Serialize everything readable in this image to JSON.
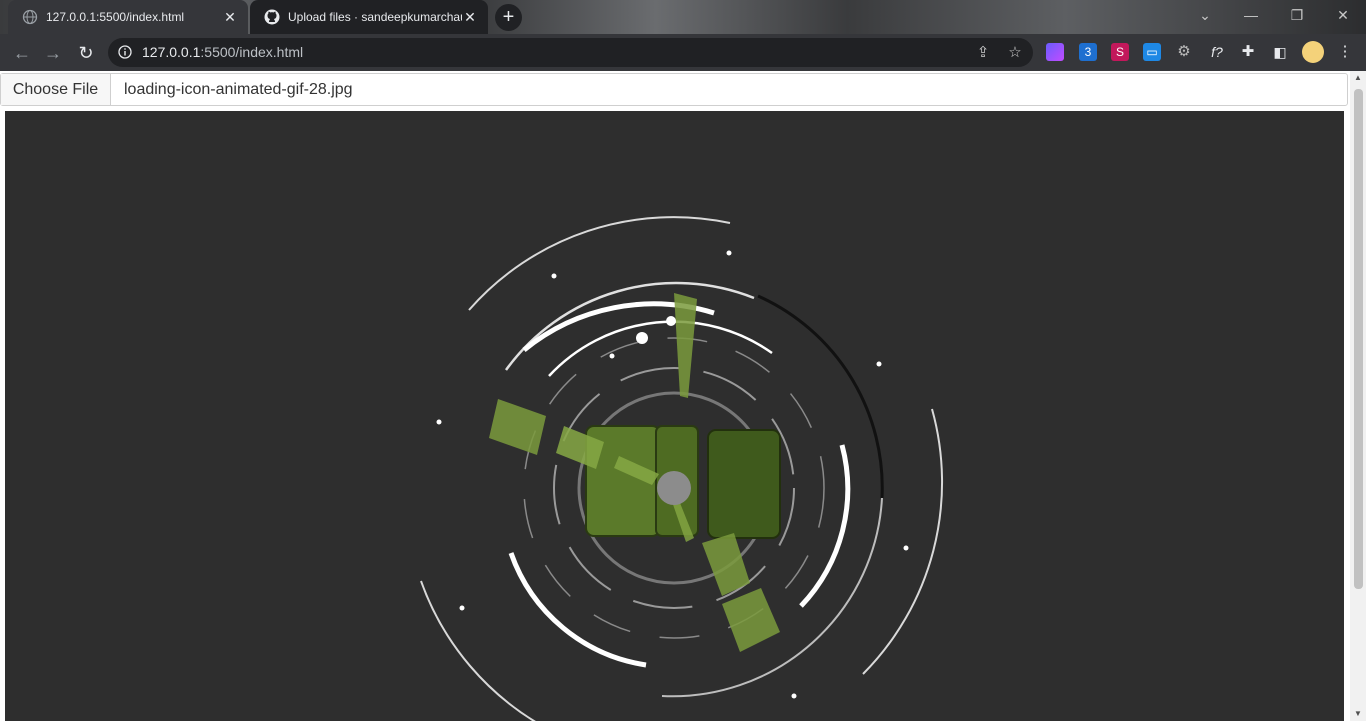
{
  "tabs": [
    {
      "title": "127.0.0.1:5500/index.html",
      "active": true,
      "icon": "globe-icon"
    },
    {
      "title": "Upload files · sandeepkumarchau",
      "active": false,
      "icon": "github-icon"
    }
  ],
  "toolbar": {
    "url_host": "127.0.0.1",
    "url_rest": ":5500/index.html"
  },
  "extensions": [
    "extension-1-icon",
    "css-extension-icon",
    "extension-3-icon",
    "extension-4-icon",
    "extension-5-icon",
    "formula-icon",
    "puzzle-icon",
    "sidepanel-icon",
    "profile-avatar"
  ],
  "file_input": {
    "button_label": "Choose File",
    "file_name": "loading-icon-animated-gif-28.jpg"
  },
  "colors": {
    "tab_strip": "#3a3b3d",
    "toolbar": "#35363a",
    "omnibox": "#202124",
    "preview_bg": "#2e2e2e",
    "accent_green": "#7a9a3c"
  }
}
